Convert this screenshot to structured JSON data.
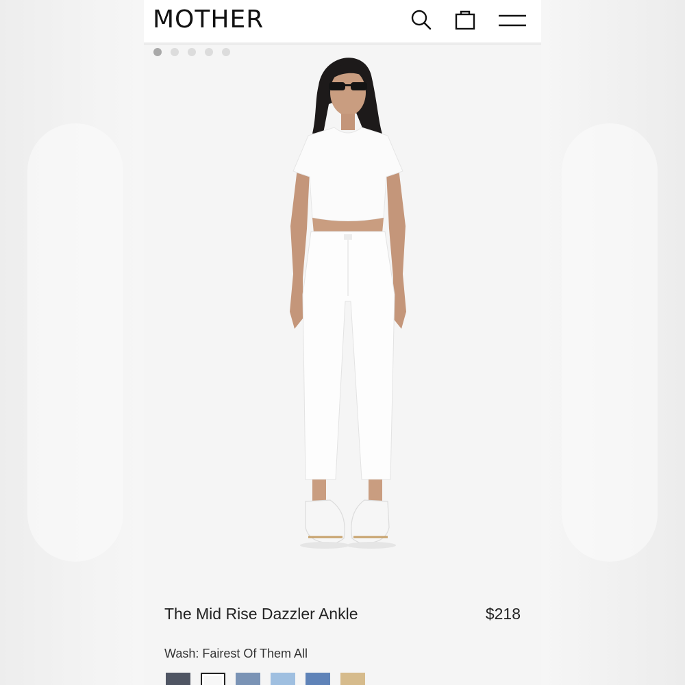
{
  "header": {
    "logo": "MOTHER"
  },
  "icons": {
    "search": "search-icon",
    "bag": "shopping-bag-icon",
    "menu": "hamburger-menu-icon"
  },
  "gallery": {
    "image_count": 5,
    "active_index": 0
  },
  "product": {
    "title": "The Mid Rise Dazzler Ankle",
    "price": "$218",
    "wash_label": "Wash: Fairest Of Them All"
  },
  "swatches": [
    {
      "name": "dark-grey",
      "color": "#4f5563"
    },
    {
      "name": "white",
      "color": "#f7f7f7",
      "selected": true
    },
    {
      "name": "mid-blue",
      "color": "#7a93b5"
    },
    {
      "name": "light-blue",
      "color": "#9fbfe0"
    },
    {
      "name": "medium-blue",
      "color": "#5f83b8"
    },
    {
      "name": "tan",
      "color": "#d6bb8c"
    }
  ],
  "colors": {
    "accent": "#111111",
    "background": "#f5f5f5"
  }
}
